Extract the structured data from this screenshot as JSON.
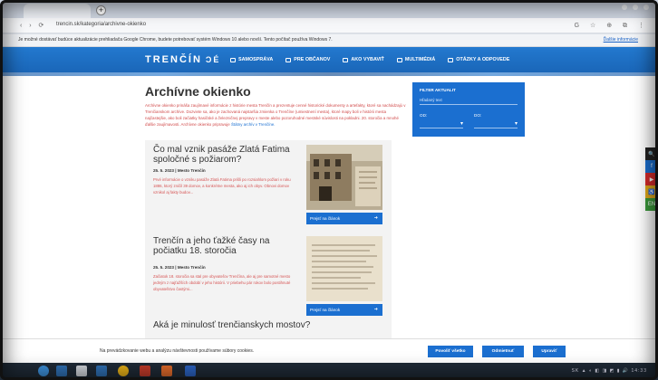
{
  "browser": {
    "url": "trencin.sk/kategoria/archivne-okienko",
    "new_tab_label": "+",
    "nav_buttons": "‹ › ⟳",
    "toolbar_icons": "G ☆ ⊕ ⧉ ⋮",
    "info_text": "Je možné dostávať budúce aktualizácie prehliadača Google Chrome, budete potrebovať systém Windows 10 alebo novší. Tento počítač používa Windows 7.",
    "info_link": "Ďalšie informácie"
  },
  "site": {
    "logo": "TRENČÍN",
    "logo_mark": "ƆÉ",
    "nav": [
      {
        "label": "SAMOSPRÁVA"
      },
      {
        "label": "PRE OBČANOV"
      },
      {
        "label": "AKO VYBAVIŤ"
      },
      {
        "label": "MULTIMÉDIÁ"
      },
      {
        "label": "OTÁZKY A ODPOVEDE"
      }
    ]
  },
  "main": {
    "title": "Archívne okienko",
    "intro": "Archívne okienko prináša zaujímavé informácie z histórie mesta Trenčín a prezentuje cenné historické dokumenty a artefakty, ktoré sa nachádzajú v Trenčianskom archíve. Dozviete sa, ako je zachovaná najstaršia zmienka o Trenčíne (umiestnení mesta), ktoré mapy boli v histórii mesta najčastejšie, ako boli začiatky hasičské a železničnej prepravy v meste alebo pozoruhodné mestské súvislosti na pokladni. 20. storočia a mnohé ďalšie zaujímavosti. Archívne okienko pripravuje",
    "intro_link": "Štátny archív v Trenčíne."
  },
  "filter": {
    "title": "FILTER AKTUALIT",
    "search_placeholder": "Hľadaný text",
    "from_label": "OD:",
    "to_label": "DO:",
    "dropdown_icon": "▾"
  },
  "articles": [
    {
      "title": "Čo mal vznik pasáže Zlatá Fatima spoločné s požiarom?",
      "meta": "25. 5. 2023 | Mesto Trenčín",
      "text": "Prvé informácie o vzniku pasáže Zlatá Fatima prišli po rozsiahlom požiari v roku 1886, ktorý zničil 39 domov, a konkrétne mesta, ako aj ich obyv. Obnovi domov vznikol aj fakty budov...",
      "button": "Prejsť na článok",
      "button_arrow": "➜"
    },
    {
      "title": "Trenčín a jeho ťažké časy na počiatku 18. storočia",
      "meta": "25. 5. 2023 | Mesto Trenčín",
      "text": "Začiatok 18. storočia sa stal pre obyvateľov Trenčína, ale aj pre samotné mesto jedným z najťažších období v jeho histórii. V priebehu pár rokov bolo postihnuté obyvateľstvo častými...",
      "button": "Prejsť na článok",
      "button_arrow": "➜"
    },
    {
      "title": "Aká je minulosť trenčianskych mostov?"
    }
  ],
  "side_buttons": [
    {
      "icon": "search-icon",
      "glyph": "🔍",
      "color": "#222222"
    },
    {
      "icon": "facebook-icon",
      "glyph": "f",
      "color": "#1b6fd0"
    },
    {
      "icon": "youtube-icon",
      "glyph": "▶",
      "color": "#d62b2b"
    },
    {
      "icon": "accessibility-icon",
      "glyph": "♿",
      "color": "#e0a81a"
    },
    {
      "icon": "language-icon",
      "glyph": "EN",
      "color": "#3b9a3b"
    }
  ],
  "cookie": {
    "text": "Na prevádzkovanie webu a analýzu návštevnosti používame súbory cookies.",
    "accept_all": "Povoliť všetko",
    "reject": "Odmietnuť",
    "customize": "Upraviť"
  },
  "taskbar": {
    "tray": "SK ▲ ◐ ◧ ◨ ◩ ▮ 🔊 14:33"
  }
}
